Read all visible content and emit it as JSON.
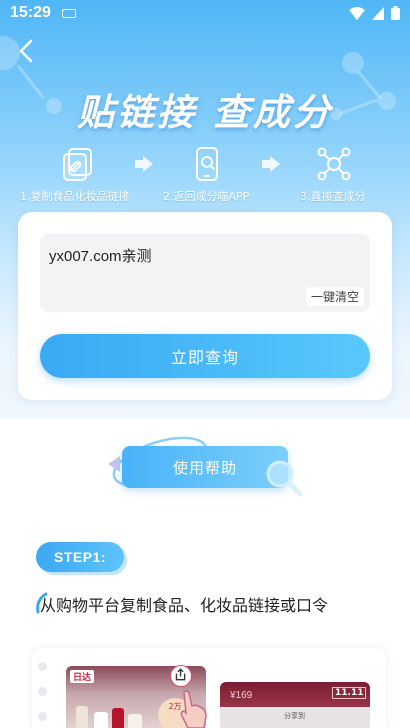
{
  "status_bar": {
    "time": "15:29"
  },
  "header": {
    "headline": "贴链接 查成分"
  },
  "steps": [
    {
      "label": "1.复制食品化妆品链接",
      "icon": "link-copy-icon"
    },
    {
      "label": "2.返回成分喵APP",
      "icon": "phone-search-icon"
    },
    {
      "label": "3.直接查成分",
      "icon": "molecule-icon"
    }
  ],
  "query_card": {
    "input_value": "yx007.com亲测",
    "clear_label": "一键清空",
    "query_button": "立即查询"
  },
  "help": {
    "button_label": "使用帮助"
  },
  "guide": {
    "step_badge": "STEP1:",
    "step_title": "从购物平台复制食品、化妆品链接或口令",
    "demo_left": {
      "logo": "日达",
      "promo": "2万"
    },
    "demo_right": {
      "price": "¥169",
      "tag": "11.11",
      "label": "分享到"
    }
  },
  "colors": {
    "accent": "#3ba8f4",
    "hero_top": "#4fb6f6",
    "text_dark": "#222222"
  }
}
